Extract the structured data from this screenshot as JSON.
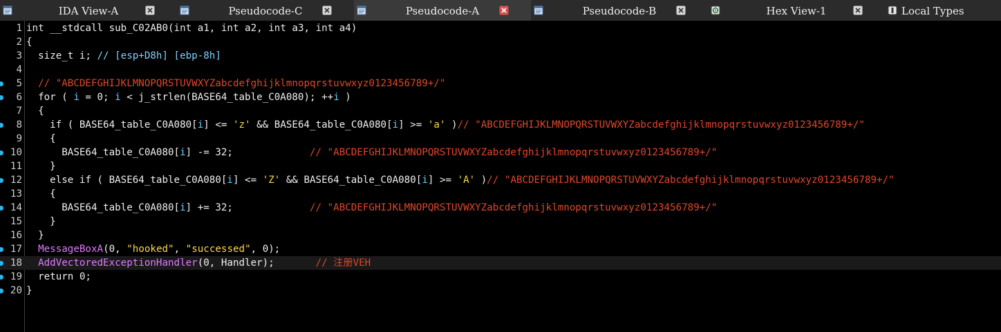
{
  "tabs": [
    {
      "label": "IDA View-A",
      "icon": "ida-view-icon",
      "close": "close-icon",
      "active": false
    },
    {
      "label": "Pseudocode-C",
      "icon": "pseudocode-icon",
      "close": "close-icon",
      "active": false
    },
    {
      "label": "Pseudocode-A",
      "icon": "pseudocode-icon",
      "close": "close-icon-red",
      "active": true
    },
    {
      "label": "Pseudocode-B",
      "icon": "pseudocode-icon",
      "close": "close-icon",
      "active": false
    },
    {
      "label": "Hex View-1",
      "icon": "hex-view-icon",
      "close": "close-icon",
      "active": false
    },
    {
      "label": "Local Types",
      "icon": "local-types-icon",
      "close": "",
      "active": false
    }
  ],
  "colors": {
    "background": "#000000",
    "breakpoint_dot": "#27b8f0",
    "comment": "#e1462c",
    "string": "#ffd94a",
    "api_call": "#e07bff",
    "variable": "#5ad4ff"
  },
  "code_lines": [
    {
      "n": "1",
      "dot": false,
      "tokens": [
        [
          "t-kw",
          "int"
        ],
        [
          "t-txt",
          " __stdcall sub_C02AB0("
        ],
        [
          "t-kw",
          "int"
        ],
        [
          "t-txt",
          " a1, "
        ],
        [
          "t-kw",
          "int"
        ],
        [
          "t-txt",
          " a2, "
        ],
        [
          "t-kw",
          "int"
        ],
        [
          "t-txt",
          " a3, "
        ],
        [
          "t-kw",
          "int"
        ],
        [
          "t-txt",
          " a4)"
        ]
      ]
    },
    {
      "n": "2",
      "dot": false,
      "tokens": [
        [
          "t-txt",
          "{"
        ]
      ]
    },
    {
      "n": "3",
      "dot": false,
      "tokens": [
        [
          "t-txt",
          "  size_t i; "
        ],
        [
          "t-cmb",
          "// [esp+D8h] [ebp-8h]"
        ]
      ]
    },
    {
      "n": "4",
      "dot": false,
      "tokens": []
    },
    {
      "n": "5",
      "dot": true,
      "tokens": [
        [
          "t-txt",
          "  "
        ],
        [
          "t-cm",
          "// \"ABCDEFGHIJKLMNOPQRSTUVWXYZabcdefghijklmnopqrstuvwxyz0123456789+/\""
        ]
      ]
    },
    {
      "n": "6",
      "dot": true,
      "tokens": [
        [
          "t-txt",
          "  for ( "
        ],
        [
          "t-var",
          "i"
        ],
        [
          "t-txt",
          " = 0; "
        ],
        [
          "t-var",
          "i"
        ],
        [
          "t-txt",
          " < j_strlen(BASE64_table_C0A080); ++"
        ],
        [
          "t-var",
          "i"
        ],
        [
          "t-txt",
          " )"
        ]
      ]
    },
    {
      "n": "7",
      "dot": false,
      "tokens": [
        [
          "t-txt",
          "  {"
        ]
      ]
    },
    {
      "n": "8",
      "dot": true,
      "tokens": [
        [
          "t-txt",
          "    if ( BASE64_table_C0A080["
        ],
        [
          "t-var",
          "i"
        ],
        [
          "t-txt",
          "] <= "
        ],
        [
          "t-chr",
          "'z'"
        ],
        [
          "t-txt",
          " && BASE64_table_C0A080["
        ],
        [
          "t-var",
          "i"
        ],
        [
          "t-txt",
          "] >= "
        ],
        [
          "t-chr",
          "'a'"
        ],
        [
          "t-txt",
          " )"
        ],
        [
          "t-cm",
          "// \"ABCDEFGHIJKLMNOPQRSTUVWXYZabcdefghijklmnopqrstuvwxyz0123456789+/\""
        ]
      ]
    },
    {
      "n": "9",
      "dot": false,
      "tokens": [
        [
          "t-txt",
          "    {"
        ]
      ]
    },
    {
      "n": "10",
      "dot": true,
      "tokens": [
        [
          "t-txt",
          "      BASE64_table_C0A080["
        ],
        [
          "t-var",
          "i"
        ],
        [
          "t-txt",
          "] -= 32;             "
        ],
        [
          "t-cm",
          "// \"ABCDEFGHIJKLMNOPQRSTUVWXYZabcdefghijklmnopqrstuvwxyz0123456789+/\""
        ]
      ]
    },
    {
      "n": "11",
      "dot": false,
      "tokens": [
        [
          "t-txt",
          "    }"
        ]
      ]
    },
    {
      "n": "12",
      "dot": true,
      "tokens": [
        [
          "t-txt",
          "    else if ( BASE64_table_C0A080["
        ],
        [
          "t-var",
          "i"
        ],
        [
          "t-txt",
          "] <= "
        ],
        [
          "t-chr",
          "'Z'"
        ],
        [
          "t-txt",
          " && BASE64_table_C0A080["
        ],
        [
          "t-var",
          "i"
        ],
        [
          "t-txt",
          "] >= "
        ],
        [
          "t-chr",
          "'A'"
        ],
        [
          "t-txt",
          " )"
        ],
        [
          "t-cm",
          "// \"ABCDEFGHIJKLMNOPQRSTUVWXYZabcdefghijklmnopqrstuvwxyz0123456789+/\""
        ]
      ]
    },
    {
      "n": "13",
      "dot": false,
      "tokens": [
        [
          "t-txt",
          "    {"
        ]
      ]
    },
    {
      "n": "14",
      "dot": true,
      "tokens": [
        [
          "t-txt",
          "      BASE64_table_C0A080["
        ],
        [
          "t-var",
          "i"
        ],
        [
          "t-txt",
          "] += 32;             "
        ],
        [
          "t-cm",
          "// \"ABCDEFGHIJKLMNOPQRSTUVWXYZabcdefghijklmnopqrstuvwxyz0123456789+/\""
        ]
      ]
    },
    {
      "n": "15",
      "dot": false,
      "tokens": [
        [
          "t-txt",
          "    }"
        ]
      ]
    },
    {
      "n": "16",
      "dot": false,
      "tokens": [
        [
          "t-txt",
          "  }"
        ]
      ]
    },
    {
      "n": "17",
      "dot": true,
      "tokens": [
        [
          "t-txt",
          "  "
        ],
        [
          "t-api",
          "MessageBoxA"
        ],
        [
          "t-txt",
          "(0, "
        ],
        [
          "t-str",
          "\"hooked\""
        ],
        [
          "t-txt",
          ", "
        ],
        [
          "t-str",
          "\"successed\""
        ],
        [
          "t-txt",
          ", 0);"
        ]
      ]
    },
    {
      "n": "18",
      "dot": true,
      "current": true,
      "tokens": [
        [
          "t-txt",
          "  "
        ],
        [
          "t-api",
          "AddVectoredExceptionHandler"
        ],
        [
          "t-txt",
          "(0, Handler);       "
        ],
        [
          "t-cm",
          "// 注册VEH"
        ]
      ]
    },
    {
      "n": "19",
      "dot": true,
      "tokens": [
        [
          "t-txt",
          "  return 0;"
        ]
      ]
    },
    {
      "n": "20",
      "dot": true,
      "tokens": [
        [
          "t-txt",
          "}"
        ]
      ]
    }
  ]
}
